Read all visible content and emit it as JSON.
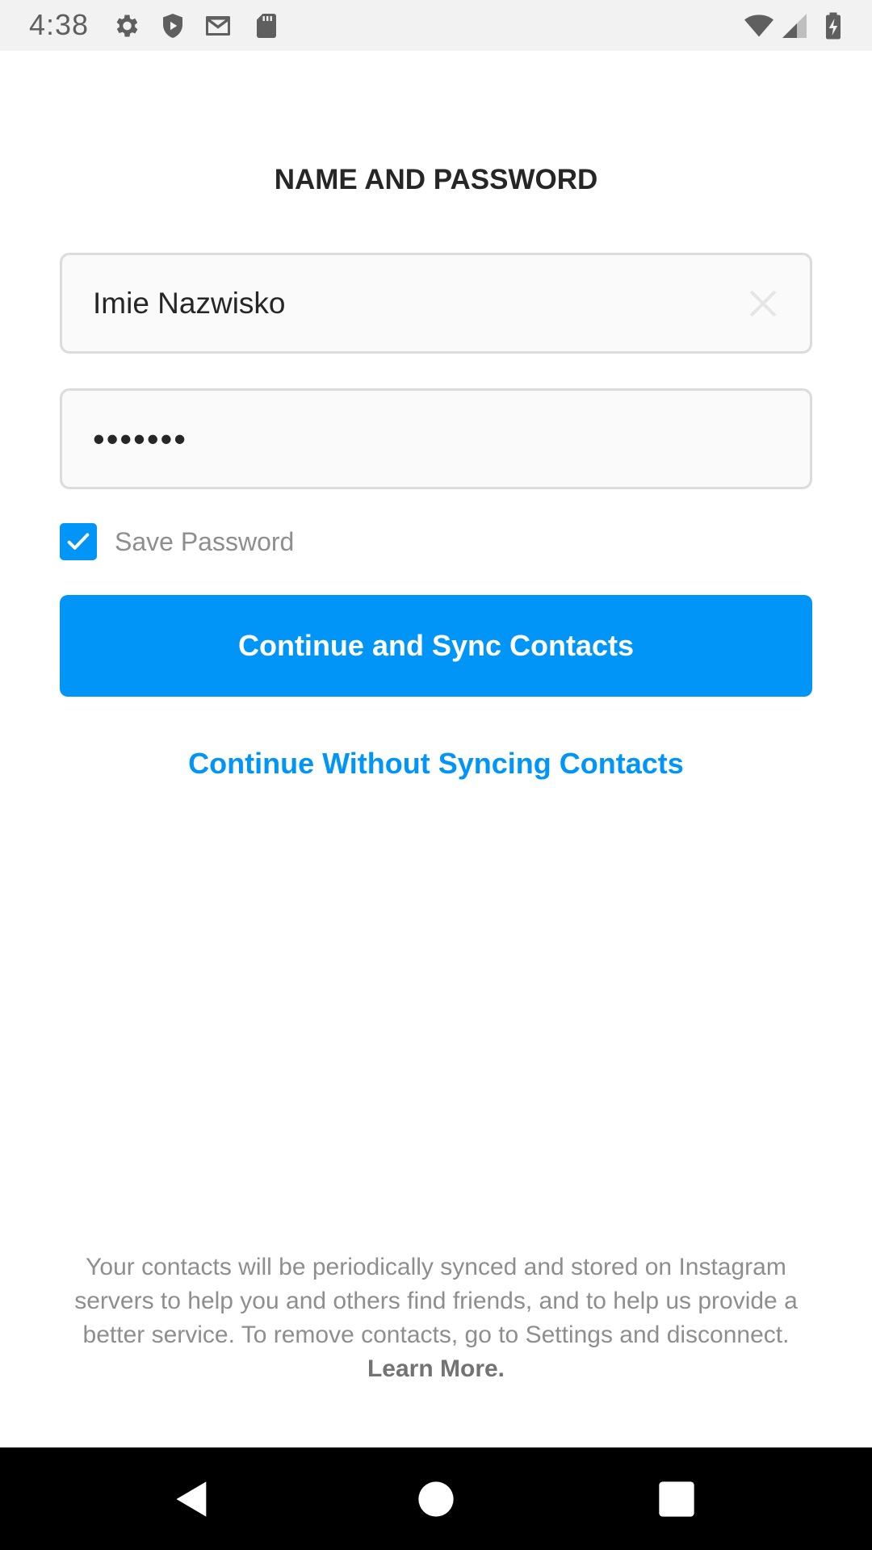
{
  "status_bar": {
    "time": "4:38",
    "left_icons": [
      "settings-icon",
      "shield-icon",
      "gmail-icon",
      "sd-card-icon"
    ],
    "right_icons": [
      "wifi-icon",
      "signal-icon",
      "battery-charging-icon"
    ]
  },
  "page": {
    "title": "NAME AND PASSWORD"
  },
  "form": {
    "name_value": "Imie Nazwisko",
    "password_value": "•••••••",
    "save_password_label": "Save Password",
    "save_password_checked": true
  },
  "actions": {
    "primary_label": "Continue and Sync Contacts",
    "secondary_label": "Continue Without Syncing Contacts"
  },
  "footer": {
    "note": "Your contacts will be periodically synced and stored on Instagram servers to help you and others find friends, and to help us provide a better service. To remove contacts, go to Settings and disconnect.",
    "learn_more": "Learn More."
  },
  "nav_bar": {
    "icons": [
      "back-icon",
      "home-icon",
      "recents-icon"
    ]
  },
  "colors": {
    "accent": "#0095f6",
    "text_primary": "#262626",
    "text_secondary": "#8e8e8e",
    "field_border": "#dbdbdb"
  }
}
